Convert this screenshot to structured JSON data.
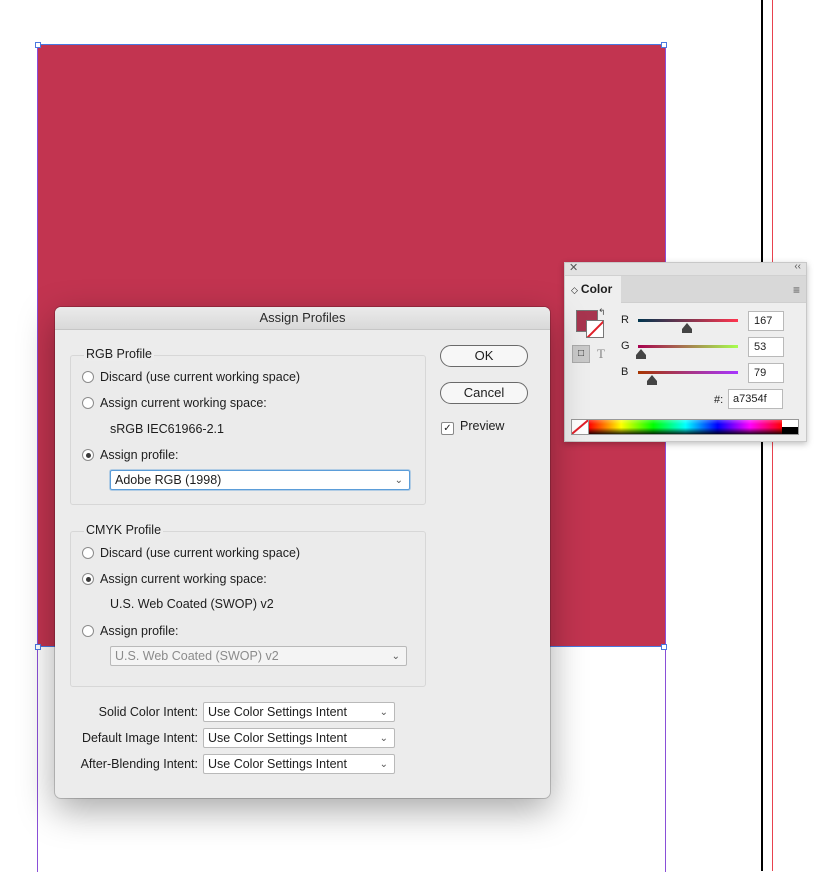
{
  "dialog": {
    "title": "Assign Profiles",
    "rgb": {
      "group_label": "RGB Profile",
      "discard": "Discard (use current working space)",
      "assign_working": "Assign current working space:",
      "working_profile": "sRGB IEC61966-2.1",
      "assign_profile": "Assign profile:",
      "profile_select": "Adobe RGB (1998)",
      "selected_option": "assign_profile"
    },
    "cmyk": {
      "group_label": "CMYK Profile",
      "discard": "Discard (use current working space)",
      "assign_working": "Assign current working space:",
      "working_profile": "U.S. Web Coated (SWOP) v2",
      "assign_profile": "Assign profile:",
      "profile_select": "U.S. Web Coated (SWOP) v2",
      "selected_option": "assign_working"
    },
    "buttons": {
      "ok": "OK",
      "cancel": "Cancel"
    },
    "preview": {
      "label": "Preview",
      "checked": true
    },
    "intents": {
      "solid_label": "Solid Color Intent:",
      "solid_value": "Use Color Settings Intent",
      "image_label": "Default Image Intent:",
      "image_value": "Use Color Settings Intent",
      "blend_label": "After-Blending Intent:",
      "blend_value": "Use Color Settings Intent"
    }
  },
  "color_panel": {
    "tab_label": "Color",
    "channels": [
      {
        "label": "R",
        "value": "167"
      },
      {
        "label": "G",
        "value": "53"
      },
      {
        "label": "B",
        "value": "79"
      }
    ],
    "hex_label": "#:",
    "hex_value": "a7354f",
    "fill_color": "#a7354f",
    "format_text_icon": "T"
  },
  "canvas": {
    "rect_color": "#c23450"
  }
}
